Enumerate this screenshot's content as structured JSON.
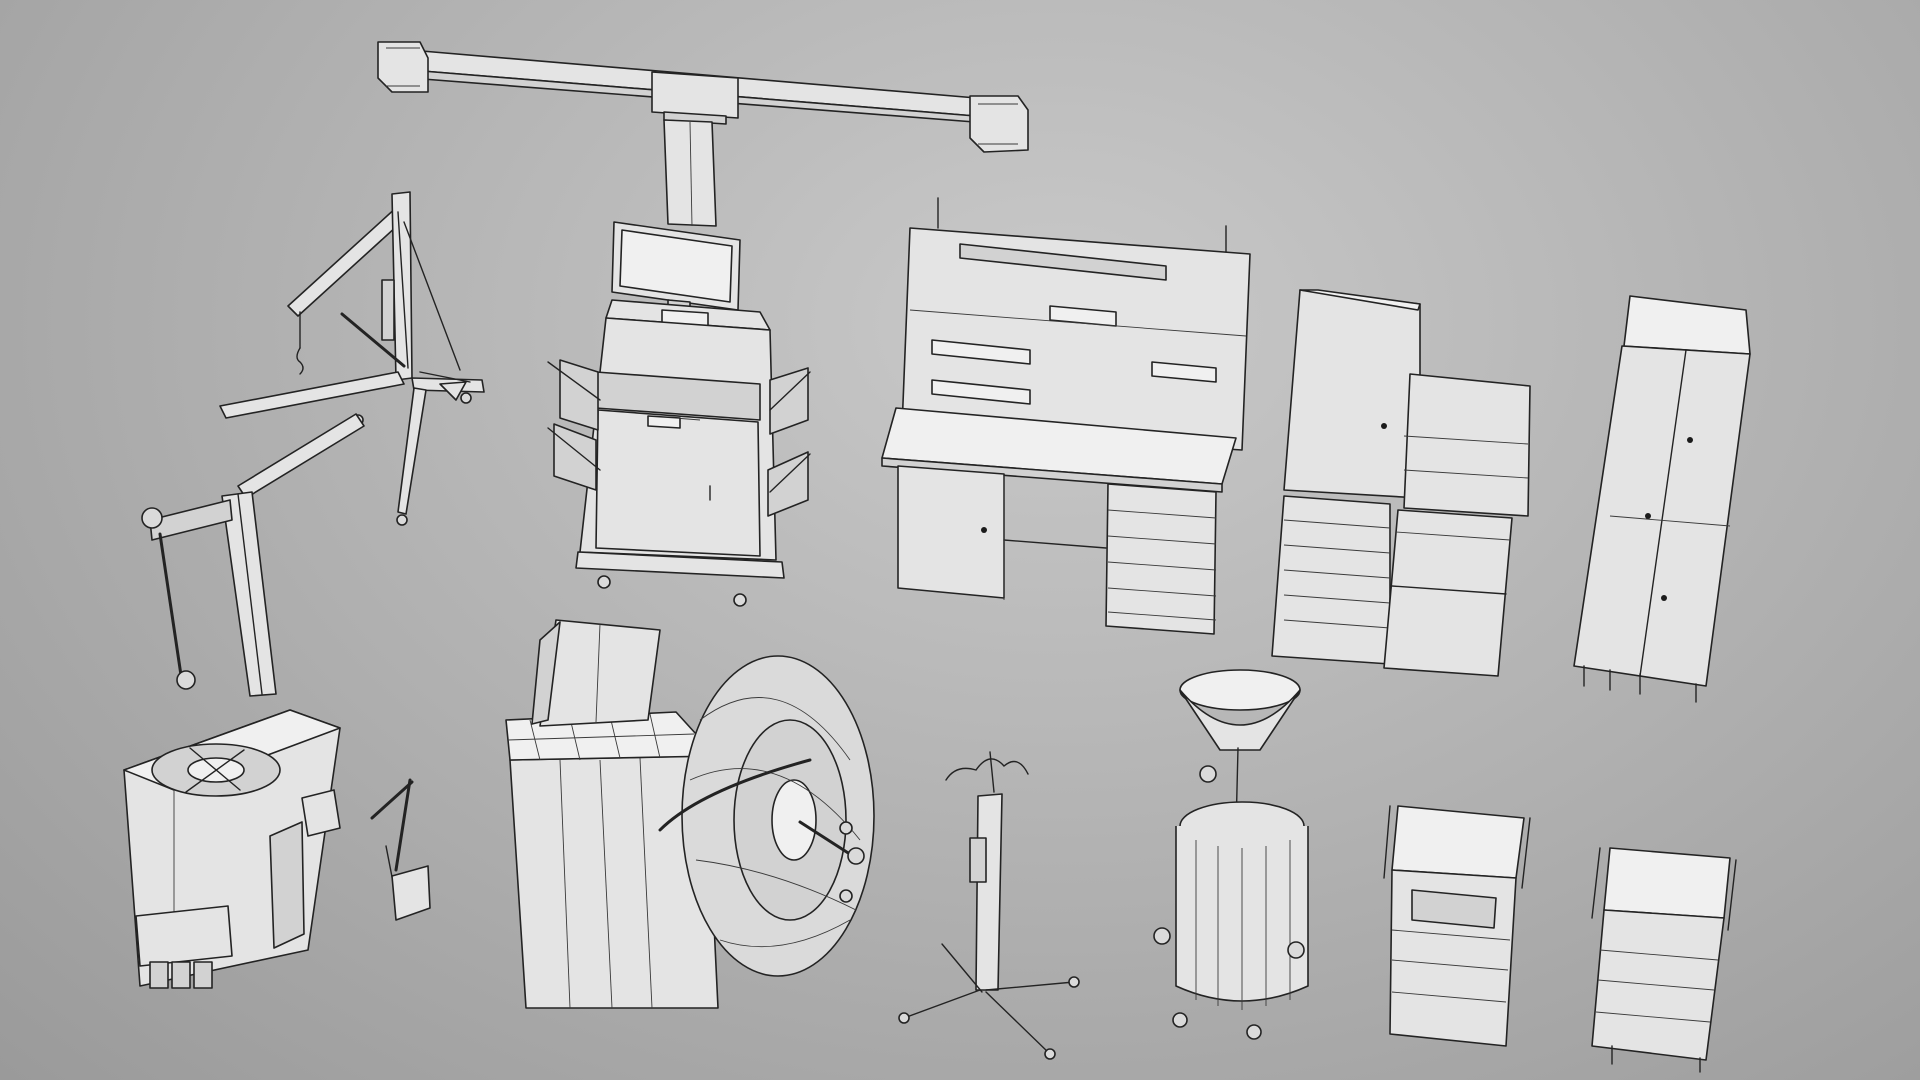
{
  "viewport": {
    "background_color": "#b4b4b4",
    "render_style": "wireframe",
    "line_color": "#232323",
    "surface_color": "#e4e4e4"
  },
  "objects": [
    {
      "name": "wheel-alignment-machine"
    },
    {
      "name": "engine-hoist-crane"
    },
    {
      "name": "workbench-with-drawers"
    },
    {
      "name": "tool-cabinet-pair"
    },
    {
      "name": "tall-wardrobe-cabinet"
    },
    {
      "name": "tire-changer-machine"
    },
    {
      "name": "wheel-balancer-machine"
    },
    {
      "name": "transmission-jack-stand"
    },
    {
      "name": "oil-drain-tank"
    },
    {
      "name": "tool-cart-left"
    },
    {
      "name": "tool-cart-right"
    }
  ]
}
